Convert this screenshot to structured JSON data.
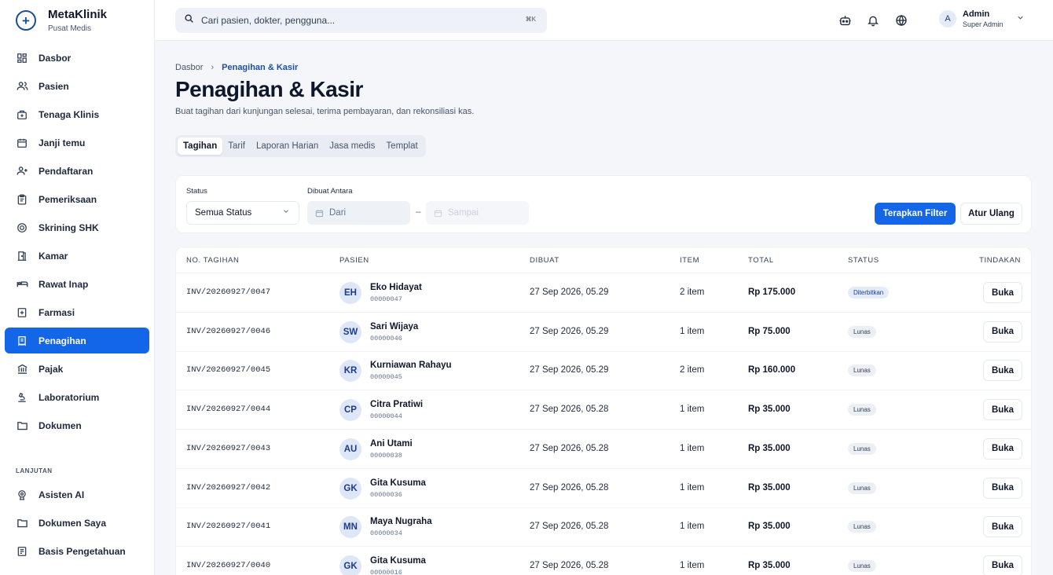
{
  "brand": {
    "name": "MetaKlinik",
    "subtitle": "Pusat Medis"
  },
  "sidebar": {
    "items": [
      {
        "label": "Dasbor",
        "icon": "grid-icon"
      },
      {
        "label": "Pasien",
        "icon": "users-icon"
      },
      {
        "label": "Tenaga Klinis",
        "icon": "medical-bag-icon"
      },
      {
        "label": "Janji temu",
        "icon": "calendar-icon"
      },
      {
        "label": "Pendaftaran",
        "icon": "user-plus-icon"
      },
      {
        "label": "Pemeriksaan",
        "icon": "clipboard-icon"
      },
      {
        "label": "Skrining SHK",
        "icon": "target-icon"
      },
      {
        "label": "Kamar",
        "icon": "door-icon"
      },
      {
        "label": "Rawat Inap",
        "icon": "bed-icon"
      },
      {
        "label": "Farmasi",
        "icon": "pharmacy-icon"
      },
      {
        "label": "Penagihan",
        "icon": "receipt-icon",
        "active": true
      },
      {
        "label": "Pajak",
        "icon": "bank-icon"
      },
      {
        "label": "Laboratorium",
        "icon": "microscope-icon"
      },
      {
        "label": "Dokumen",
        "icon": "folder-icon"
      }
    ],
    "section_label": "LANJUTAN",
    "advanced_items": [
      {
        "label": "Asisten AI",
        "icon": "ai-icon"
      },
      {
        "label": "Dokumen Saya",
        "icon": "folder-icon"
      },
      {
        "label": "Basis Pengetahuan",
        "icon": "book-icon"
      }
    ]
  },
  "header": {
    "search_placeholder": "Cari pasien, dokter, pengguna...",
    "shortcut": "⌘K",
    "user": {
      "initial": "A",
      "name": "Admin",
      "role": "Super Admin"
    }
  },
  "breadcrumb": {
    "parent": "Dasbor",
    "current": "Penagihan & Kasir"
  },
  "page": {
    "title": "Penagihan & Kasir",
    "description": "Buat tagihan dari kunjungan selesai, terima pembayaran, dan rekonsiliasi kas."
  },
  "tabs": [
    {
      "label": "Tagihan",
      "active": true
    },
    {
      "label": "Tarif"
    },
    {
      "label": "Laporan Harian"
    },
    {
      "label": "Jasa medis"
    },
    {
      "label": "Templat"
    }
  ],
  "filter": {
    "status_label": "Status",
    "status_value": "Semua Status",
    "date_label": "Dibuat Antara",
    "from_placeholder": "Dari",
    "to_placeholder": "Sampai",
    "apply_label": "Terapkan Filter",
    "reset_label": "Atur Ulang"
  },
  "table": {
    "columns": [
      "NO. TAGIHAN",
      "PASIEN",
      "DIBUAT",
      "ITEM",
      "TOTAL",
      "STATUS",
      "TINDAKAN"
    ],
    "action_label": "Buka",
    "rows": [
      {
        "invoice": "INV/20260927/0047",
        "initials": "EH",
        "name": "Eko Hidayat",
        "mrn": "00000047",
        "created": "27 Sep 2026, 05.29",
        "items": "2 item",
        "total": "Rp 175.000",
        "status": "Diterbitkan",
        "status_type": "issued"
      },
      {
        "invoice": "INV/20260927/0046",
        "initials": "SW",
        "name": "Sari Wijaya",
        "mrn": "00000046",
        "created": "27 Sep 2026, 05.29",
        "items": "1 item",
        "total": "Rp 75.000",
        "status": "Lunas",
        "status_type": "paid"
      },
      {
        "invoice": "INV/20260927/0045",
        "initials": "KR",
        "name": "Kurniawan Rahayu",
        "mrn": "00000045",
        "created": "27 Sep 2026, 05.29",
        "items": "2 item",
        "total": "Rp 160.000",
        "status": "Lunas",
        "status_type": "paid"
      },
      {
        "invoice": "INV/20260927/0044",
        "initials": "CP",
        "name": "Citra Pratiwi",
        "mrn": "00000044",
        "created": "27 Sep 2026, 05.28",
        "items": "1 item",
        "total": "Rp 35.000",
        "status": "Lunas",
        "status_type": "paid"
      },
      {
        "invoice": "INV/20260927/0043",
        "initials": "AU",
        "name": "Ani Utami",
        "mrn": "00000038",
        "created": "27 Sep 2026, 05.28",
        "items": "1 item",
        "total": "Rp 35.000",
        "status": "Lunas",
        "status_type": "paid"
      },
      {
        "invoice": "INV/20260927/0042",
        "initials": "GK",
        "name": "Gita Kusuma",
        "mrn": "00000036",
        "created": "27 Sep 2026, 05.28",
        "items": "1 item",
        "total": "Rp 35.000",
        "status": "Lunas",
        "status_type": "paid"
      },
      {
        "invoice": "INV/20260927/0041",
        "initials": "MN",
        "name": "Maya Nugraha",
        "mrn": "00000034",
        "created": "27 Sep 2026, 05.28",
        "items": "1 item",
        "total": "Rp 35.000",
        "status": "Lunas",
        "status_type": "paid"
      },
      {
        "invoice": "INV/20260927/0040",
        "initials": "GK",
        "name": "Gita Kusuma",
        "mrn": "00000016",
        "created": "27 Sep 2026, 05.28",
        "items": "1 item",
        "total": "Rp 35.000",
        "status": "Lunas",
        "status_type": "paid"
      }
    ]
  }
}
